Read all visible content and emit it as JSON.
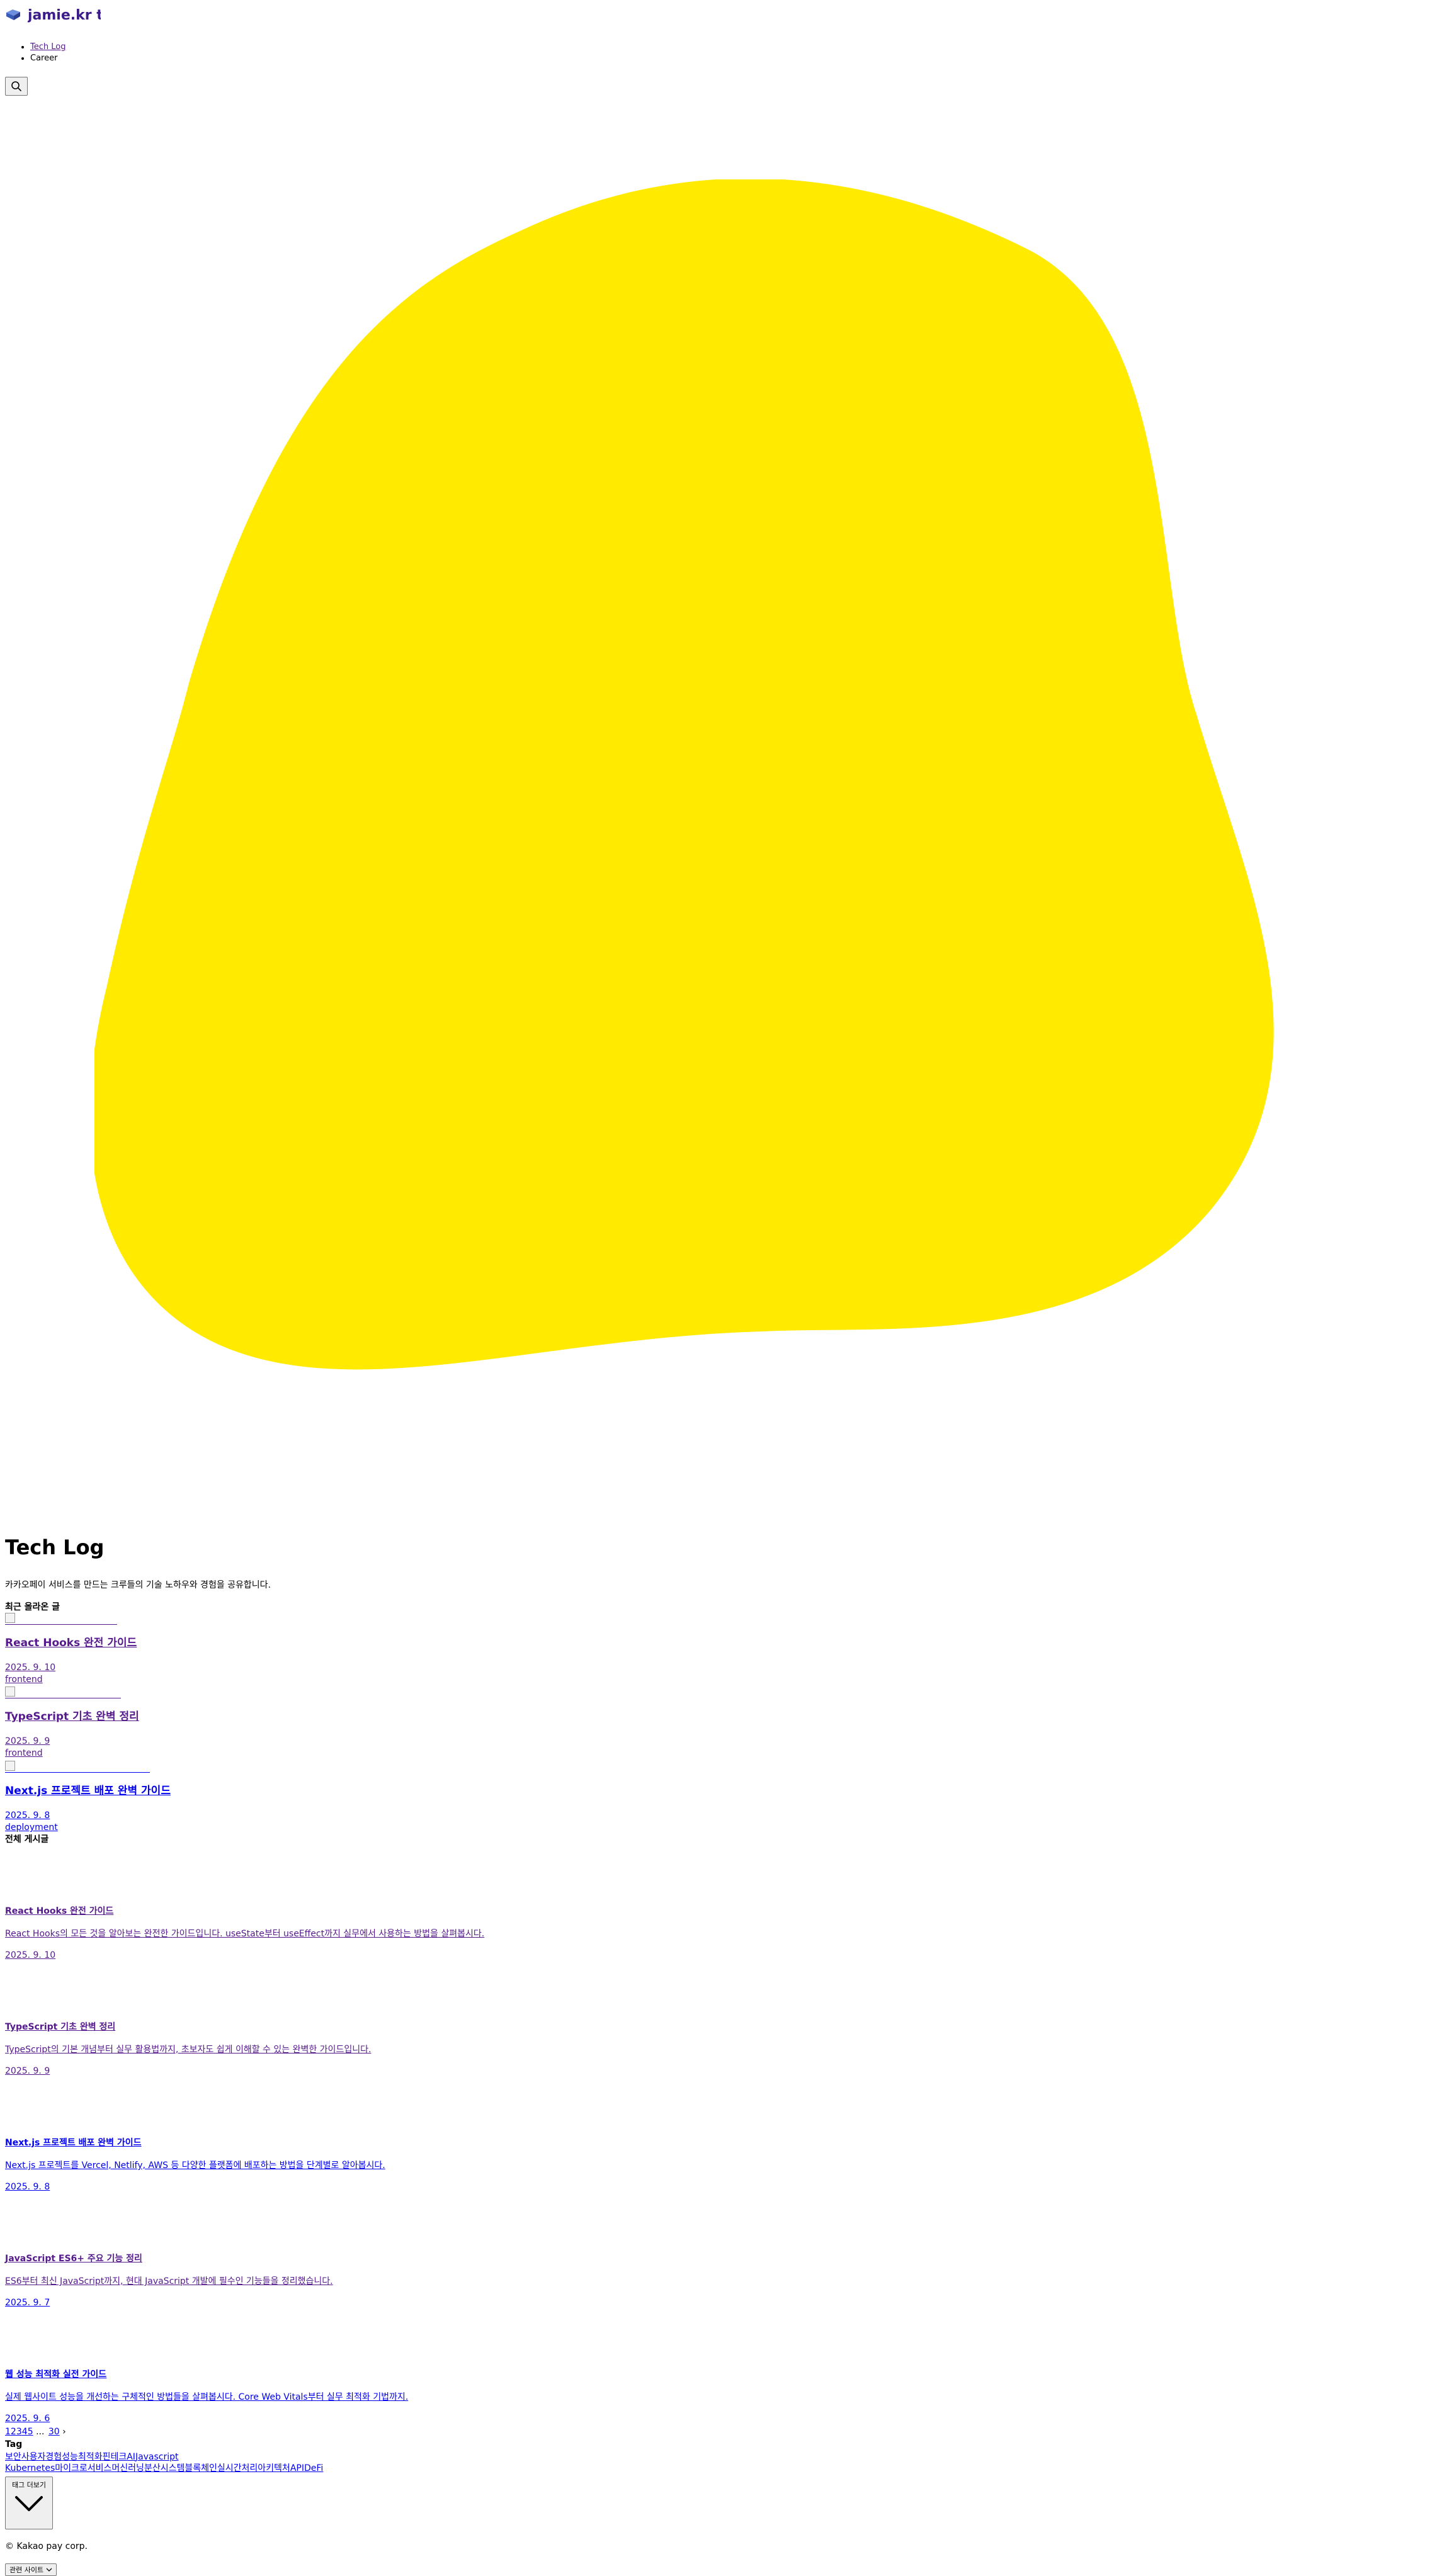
{
  "header": {
    "logo_text": "jamie.kr tech",
    "nav": [
      "Tech Log",
      "Career"
    ]
  },
  "colors": {
    "blob": "#ffea00",
    "logo": "#3b1c8a",
    "link": "#0000ee",
    "visited": "#551a8b"
  },
  "hero": {
    "title": "Tech Log",
    "description": "카카오페이 서비스를 만드는 크루들의 기술 노하우와 경험을 공유합니다."
  },
  "recent": {
    "heading": "최근 올라온 글",
    "posts": [
      {
        "title": "React Hooks 완전 가이드",
        "date": "2025. 9. 10",
        "category": "frontend"
      },
      {
        "title": "TypeScript 기초 완벽 정리",
        "date": "2025. 9. 9",
        "category": "frontend"
      },
      {
        "title": "Next.js 프로젝트 배포 완벽 가이드",
        "date": "2025. 9. 8",
        "category": "deployment"
      }
    ]
  },
  "all_posts": {
    "heading": "전체 게시글",
    "posts": [
      {
        "title": "React Hooks 완전 가이드",
        "summary": "React Hooks의 모든 것을 알아보는 완전한 가이드입니다. useState부터 useEffect까지 실무에서 사용하는 방법을 살펴봅시다.",
        "date": "2025. 9. 10"
      },
      {
        "title": "TypeScript 기초 완벽 정리",
        "summary": "TypeScript의 기본 개념부터 실무 활용법까지, 초보자도 쉽게 이해할 수 있는 완벽한 가이드입니다.",
        "date": "2025. 9. 9"
      },
      {
        "title": "Next.js 프로젝트 배포 완벽 가이드",
        "summary": "Next.js 프로젝트를 Vercel, Netlify, AWS 등 다양한 플랫폼에 배포하는 방법을 단계별로 알아봅시다.",
        "date": "2025. 9. 8"
      },
      {
        "title": "JavaScript ES6+ 주요 기능 정리",
        "summary": "ES6부터 최신 JavaScript까지, 현대 JavaScript 개발에 필수인 기능들을 정리했습니다.",
        "date": "2025. 9. 7"
      },
      {
        "title": "웹 성능 최적화 실전 가이드",
        "summary": "실제 웹사이트 성능을 개선하는 구체적인 방법들을 살펴봅시다. Core Web Vitals부터 실무 최적화 기법까지.",
        "date": "2025. 9. 6"
      }
    ]
  },
  "pagination": {
    "pages": [
      "1",
      "2",
      "3",
      "4",
      "5",
      "...",
      "30"
    ],
    "next": "›"
  },
  "tags": {
    "heading": "Tag",
    "items": [
      "보안",
      "사용자경험",
      "성능최적화",
      "핀테크",
      "AI",
      "Javascript",
      "Kubernetes",
      "마이크로서비스",
      "머신러닝",
      "분산시스템",
      "블록체인",
      "실시간처리",
      "아키텍처",
      "API",
      "DeFi"
    ],
    "more_label": "태그 더보기"
  },
  "footer": {
    "copyright": "© Kakao pay corp.",
    "related_sites": "관련 사이트"
  }
}
